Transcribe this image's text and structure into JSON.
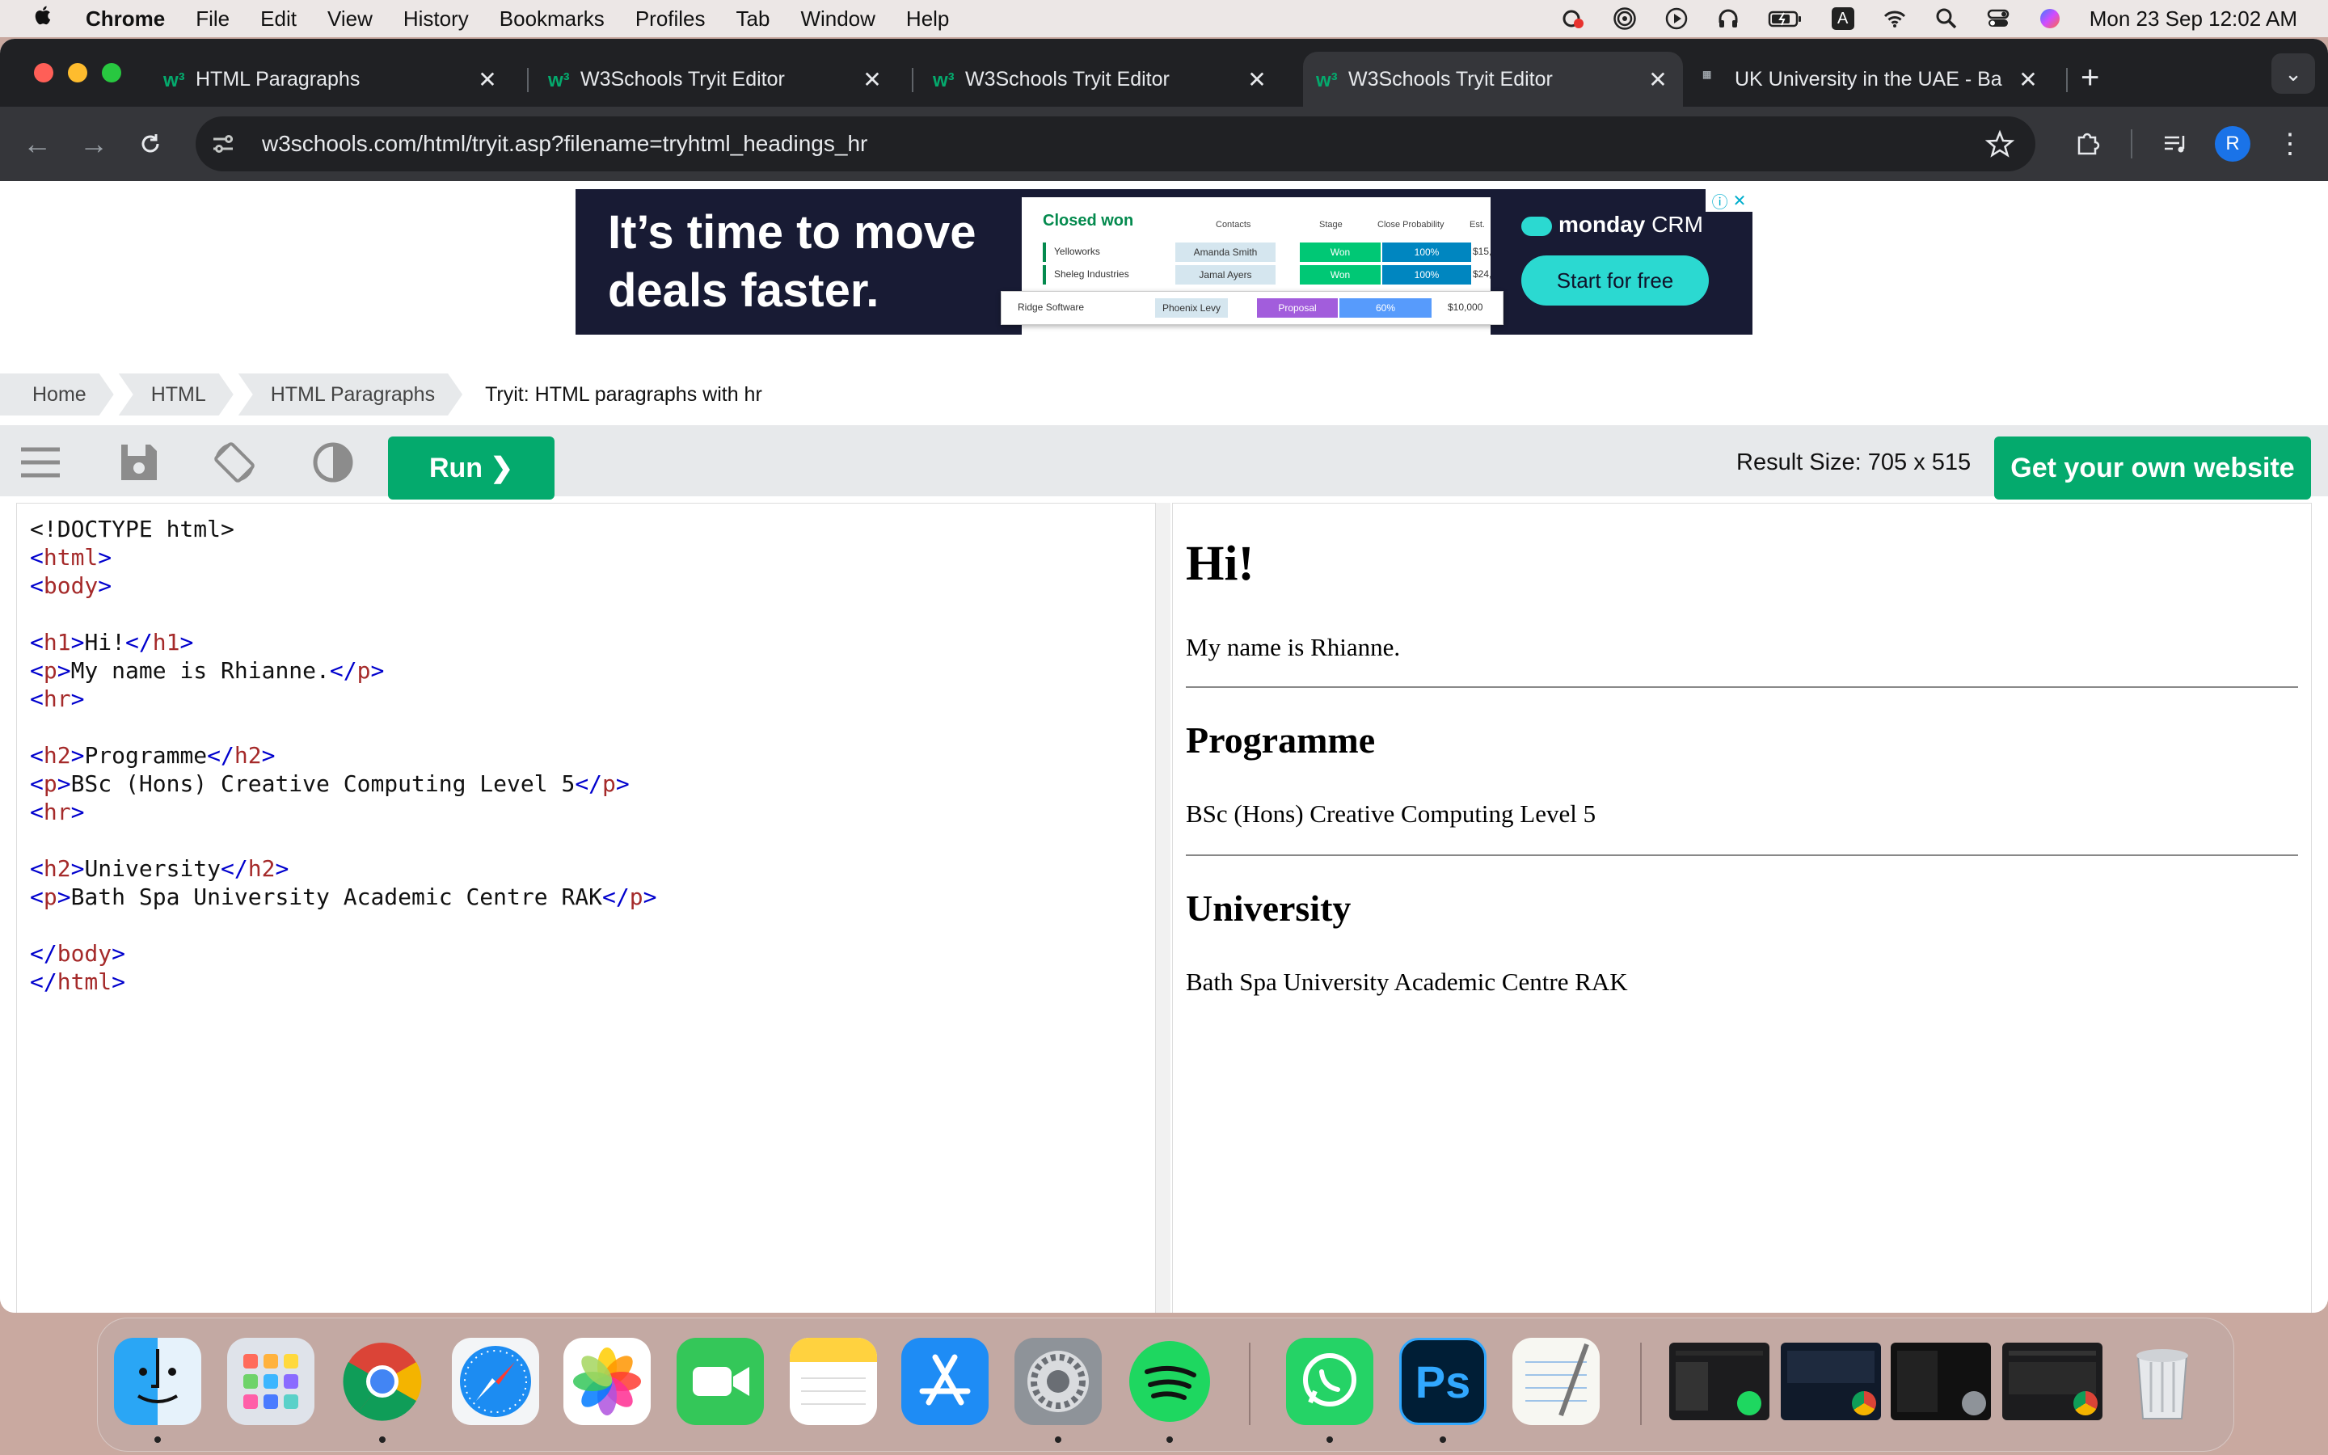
{
  "menubar": {
    "app": "Chrome",
    "items": [
      "File",
      "Edit",
      "View",
      "History",
      "Bookmarks",
      "Profiles",
      "Tab",
      "Window",
      "Help"
    ],
    "clock": "Mon 23 Sep  12:02 AM",
    "status_icons": [
      "creative-cloud-icon",
      "airdrop-icon",
      "play-icon",
      "headphones-icon",
      "battery-icon",
      "input-source-icon",
      "wifi-icon",
      "spotlight-icon",
      "control-center-icon",
      "siri-icon"
    ],
    "input_source_letter": "A"
  },
  "tabs": [
    {
      "title": "HTML Paragraphs",
      "active": false
    },
    {
      "title": "W3Schools Tryit Editor",
      "active": false
    },
    {
      "title": "W3Schools Tryit Editor",
      "active": false
    },
    {
      "title": "W3Schools Tryit Editor",
      "active": true
    },
    {
      "title": "UK University in the UAE - Ba",
      "active": false
    }
  ],
  "tab_favicon": "w³",
  "omnibox": {
    "url": "w3schools.com/html/tryit.asp?filename=tryhtml_headings_hr"
  },
  "profile_initial": "R",
  "ad": {
    "headline_1": "It’s time to move",
    "headline_2": "deals faster.",
    "table_title": "Closed won",
    "columns": [
      "Contacts",
      "Stage",
      "Close Probability",
      "Est."
    ],
    "rows": [
      {
        "name": "Yelloworks",
        "contact": "Amanda Smith",
        "stage": "Won",
        "prob": "100%",
        "est": "$15,"
      },
      {
        "name": "Sheleg Industries",
        "contact": "Jamal Ayers",
        "stage": "Won",
        "prob": "100%",
        "est": "$24,"
      }
    ],
    "card": {
      "name": "Ridge Software",
      "contact": "Phoenix Levy",
      "stage": "Proposal",
      "prob": "60%",
      "est": "$10,000"
    },
    "brand": "monday",
    "brand_suffix": "CRM",
    "cta": "Start for free"
  },
  "breadcrumb": [
    "Home",
    "HTML",
    "HTML Paragraphs",
    "Tryit: HTML paragraphs with hr"
  ],
  "tryit": {
    "run_label": "Run ❯",
    "result_size": "Result Size: 705 x 515",
    "own_site": "Get your own website"
  },
  "code_lines": [
    "<!DOCTYPE html>",
    "<html>",
    "<body>",
    "",
    "<h1>Hi!</h1>",
    "<p>My name is Rhianne.</p>",
    "<hr>",
    "",
    "<h2>Programme</h2>",
    "<p>BSc (Hons) Creative Computing Level 5</p>",
    "<hr>",
    "",
    "<h2>University</h2>",
    "<p>Bath Spa University Academic Centre RAK</p>",
    "",
    "</body>",
    "</html>"
  ],
  "result": {
    "h1": "Hi!",
    "p1": "My name is Rhianne.",
    "h2_programme": "Programme",
    "p2": "BSc (Hons) Creative Computing Level 5",
    "h2_university": "University",
    "p3": "Bath Spa University Academic Centre RAK"
  },
  "dock": {
    "apps": [
      "Finder",
      "Launchpad",
      "Google Chrome",
      "Safari",
      "Photos",
      "FaceTime",
      "Notes",
      "App Store",
      "System Settings",
      "Spotify",
      "WhatsApp",
      "Photoshop",
      "TextEdit"
    ],
    "photoshop_label": "Ps",
    "recent_windows": 4,
    "trash": "Trash"
  },
  "colors": {
    "w3_green": "#04aa6d",
    "tag_blue": "#0000cd",
    "tag_name": "#a52a2a",
    "chrome_dark": "#202124"
  }
}
